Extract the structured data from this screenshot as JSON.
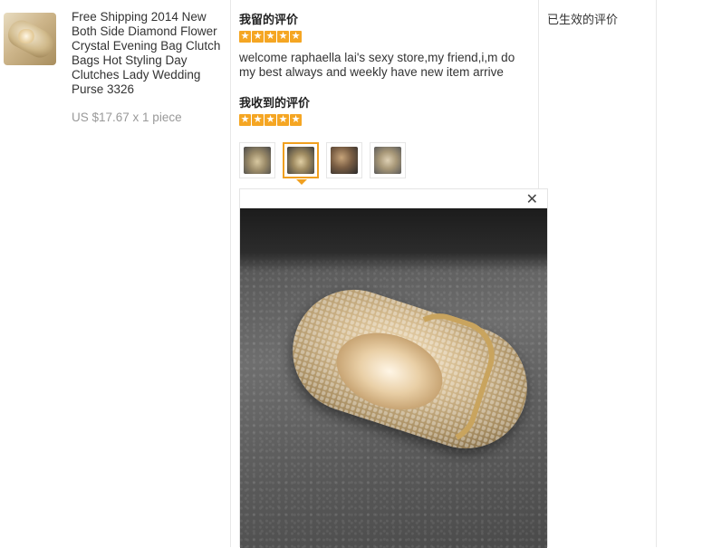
{
  "product": {
    "title": "Free Shipping 2014 New Both Side Diamond Flower Crystal Evening Bag Clutch Bags Hot Styling Day Clutches Lady Wedding Purse 3326",
    "price": "US $17.67 x 1 piece"
  },
  "given_feedback": {
    "heading": "我留的评价",
    "rating": 5,
    "comment": "welcome raphaella lai's sexy store,my friend,i,m do my best always and weekly have new item arrive"
  },
  "received_feedback": {
    "heading": "我收到的评价",
    "rating": 5,
    "photos": [
      "photo-1",
      "photo-2",
      "photo-3",
      "photo-4"
    ],
    "active_photo_index": 1
  },
  "effective": {
    "heading": "已生效的评价"
  },
  "viewer": {
    "close_symbol": "✕"
  },
  "colors": {
    "star": "#f5a623",
    "active_border": "#f0a020"
  },
  "icons": [
    "star-icon",
    "close-icon"
  ]
}
